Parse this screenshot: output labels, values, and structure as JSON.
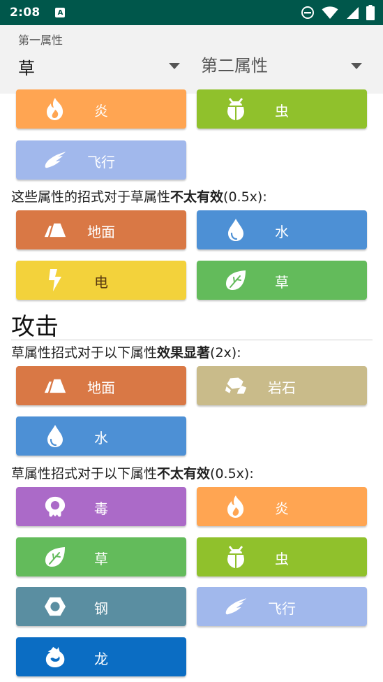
{
  "status": {
    "time": "2:08",
    "badge": "A"
  },
  "selectors": {
    "first_label": "第一属性",
    "first_value": "草",
    "second_placeholder": "第二属性"
  },
  "defense_top_buttons": [
    {
      "label": "炎",
      "icon": "flame-icon",
      "color": "#ffa552"
    },
    {
      "label": "虫",
      "icon": "bug-icon",
      "color": "#90c12c"
    },
    {
      "label": "飞行",
      "icon": "wing-icon",
      "color": "#a1b8ec"
    }
  ],
  "defense_not_effective": {
    "prefix": "这些属性的招式对于草属性",
    "emphasis": "不太有效",
    "suffix": "(0.5x):",
    "buttons": [
      {
        "label": "地面",
        "icon": "ground-icon",
        "color": "#d97845"
      },
      {
        "label": "水",
        "icon": "water-drop-icon",
        "color": "#4d90d5"
      },
      {
        "label": "电",
        "icon": "lightning-icon",
        "color": "#f3d23b"
      },
      {
        "label": "草",
        "icon": "leaf-icon",
        "color": "#63bb5b"
      }
    ]
  },
  "attack": {
    "title": "攻击",
    "super_effective": {
      "prefix": "草属性招式对于以下属性",
      "emphasis": "效果显著",
      "suffix": "(2x):",
      "buttons": [
        {
          "label": "地面",
          "icon": "ground-icon",
          "color": "#d97845"
        },
        {
          "label": "岩石",
          "icon": "rock-icon",
          "color": "#c9bb8a"
        },
        {
          "label": "水",
          "icon": "water-drop-icon",
          "color": "#4d90d5"
        }
      ]
    },
    "not_effective": {
      "prefix": "草属性招式对于以下属性",
      "emphasis": "不太有效",
      "suffix": "(0.5x):",
      "buttons": [
        {
          "label": "毒",
          "icon": "poison-icon",
          "color": "#ab6ac8"
        },
        {
          "label": "炎",
          "icon": "flame-icon",
          "color": "#ffa552"
        },
        {
          "label": "草",
          "icon": "leaf-icon",
          "color": "#63bb5b"
        },
        {
          "label": "虫",
          "icon": "bug-icon",
          "color": "#90c12c"
        },
        {
          "label": "钢",
          "icon": "steel-nut-icon",
          "color": "#5a8ea1"
        },
        {
          "label": "飞行",
          "icon": "wing-icon",
          "color": "#a1b8ec"
        },
        {
          "label": "龙",
          "icon": "dragon-icon",
          "color": "#0b6dc3"
        }
      ]
    }
  }
}
